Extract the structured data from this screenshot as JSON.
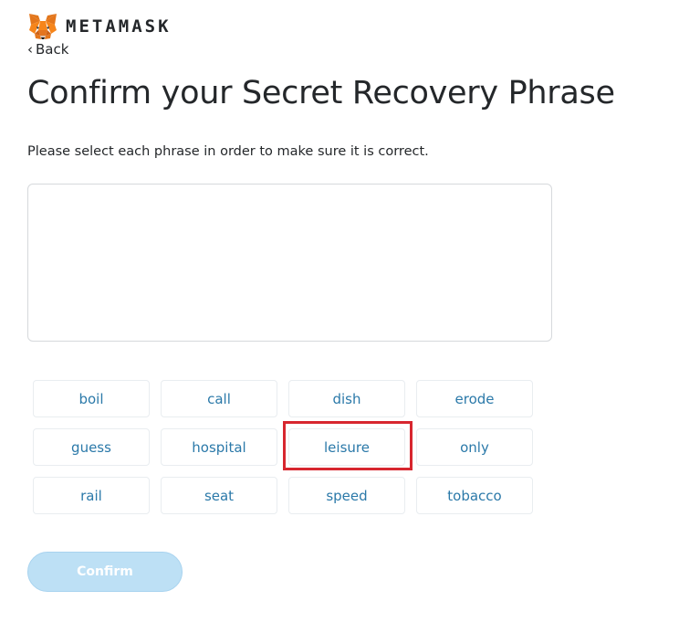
{
  "brand": {
    "wordmark": "METAMASK",
    "logo_icon": "metamask-fox-icon"
  },
  "nav": {
    "back_chevron": "‹",
    "back_label": "Back"
  },
  "page": {
    "title": "Confirm your Secret Recovery Phrase",
    "subtitle": "Please select each phrase in order to make sure it is correct."
  },
  "words": [
    "boil",
    "call",
    "dish",
    "erode",
    "guess",
    "hospital",
    "leisure",
    "only",
    "rail",
    "seat",
    "speed",
    "tobacco"
  ],
  "highlighted_word": "leisure",
  "actions": {
    "confirm_label": "Confirm",
    "confirm_enabled": false
  },
  "colors": {
    "word_text": "#2b79a9",
    "highlight_border": "#d7262f",
    "confirm_disabled_bg": "#bde0f5"
  }
}
